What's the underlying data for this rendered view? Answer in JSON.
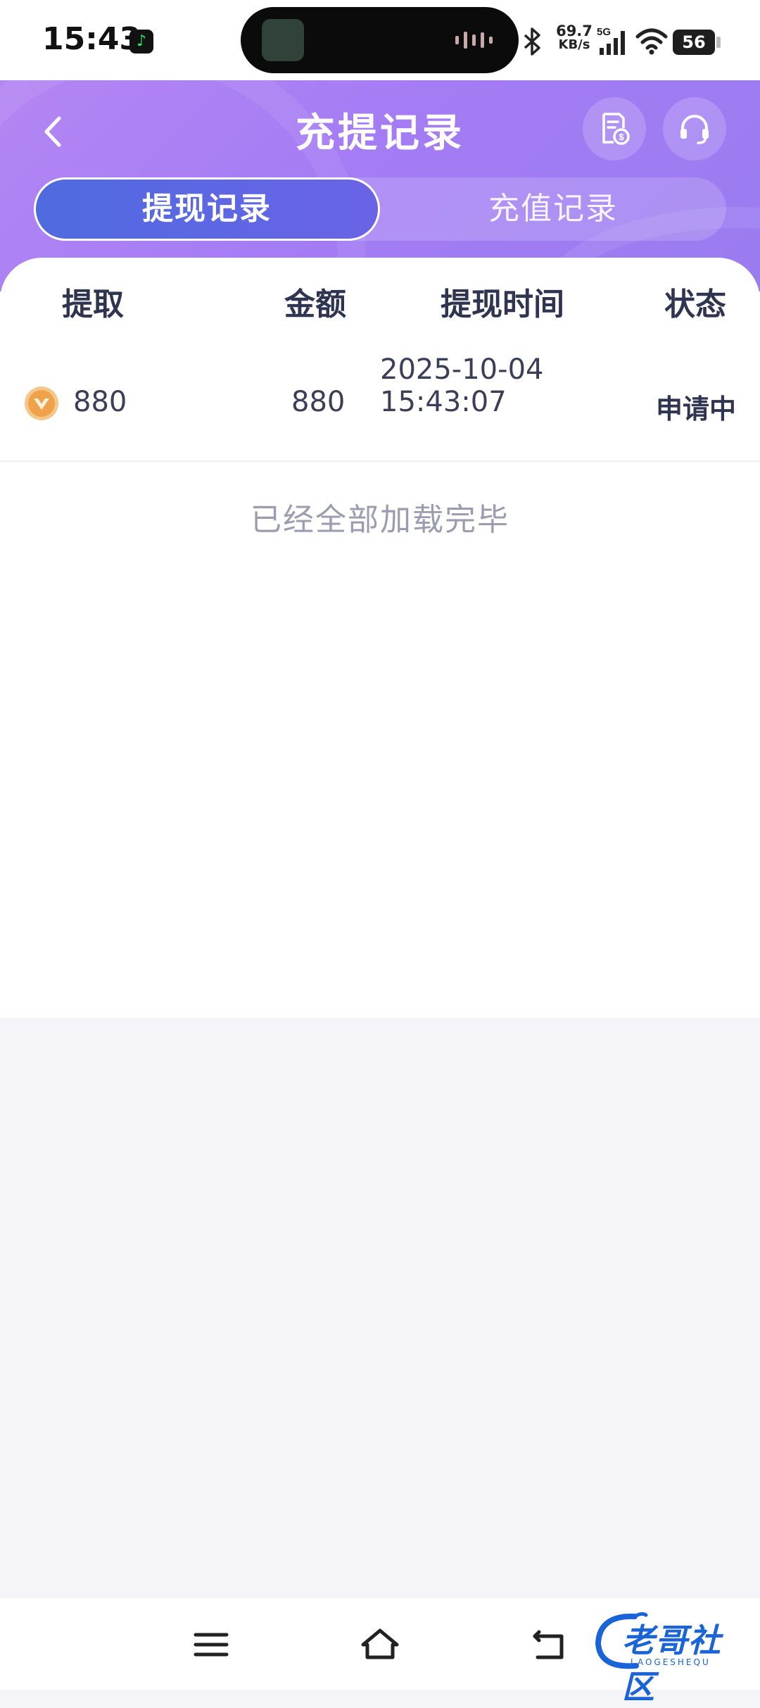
{
  "status_bar": {
    "time": "15:43",
    "net_speed_value": "69.7",
    "net_speed_unit": "KB/s",
    "network": "5G",
    "battery": "56"
  },
  "header": {
    "title": "充提记录",
    "back_icon": "chevron-left-icon",
    "bill_icon": "bill-dollar-icon",
    "support_icon": "headset-icon"
  },
  "tabs": [
    {
      "label": "提现记录",
      "active": true
    },
    {
      "label": "充值记录",
      "active": false
    }
  ],
  "table": {
    "headers": [
      "提取",
      "金额",
      "提现时间",
      "状态"
    ],
    "rows": [
      {
        "icon": "coin-icon",
        "extract": "880",
        "amount": "880",
        "date": "2025-10-04",
        "time": "15:43:07",
        "status": "申请中"
      }
    ],
    "end_message": "已经全部加载完毕"
  },
  "nav_bar": {
    "menu_icon": "menu-icon",
    "home_icon": "home-icon",
    "back_icon": "back-arrow-icon"
  },
  "watermark": {
    "text": "老哥社区",
    "subtext": "LAOGESHEQU"
  },
  "colors": {
    "header_gradient_start": "#b486f3",
    "header_gradient_end": "#9a7cf0",
    "active_tab": "#5a68e3",
    "text_dark": "#2f3551",
    "text_muted": "#9a9db0",
    "page_bg": "#f4f4f9"
  }
}
